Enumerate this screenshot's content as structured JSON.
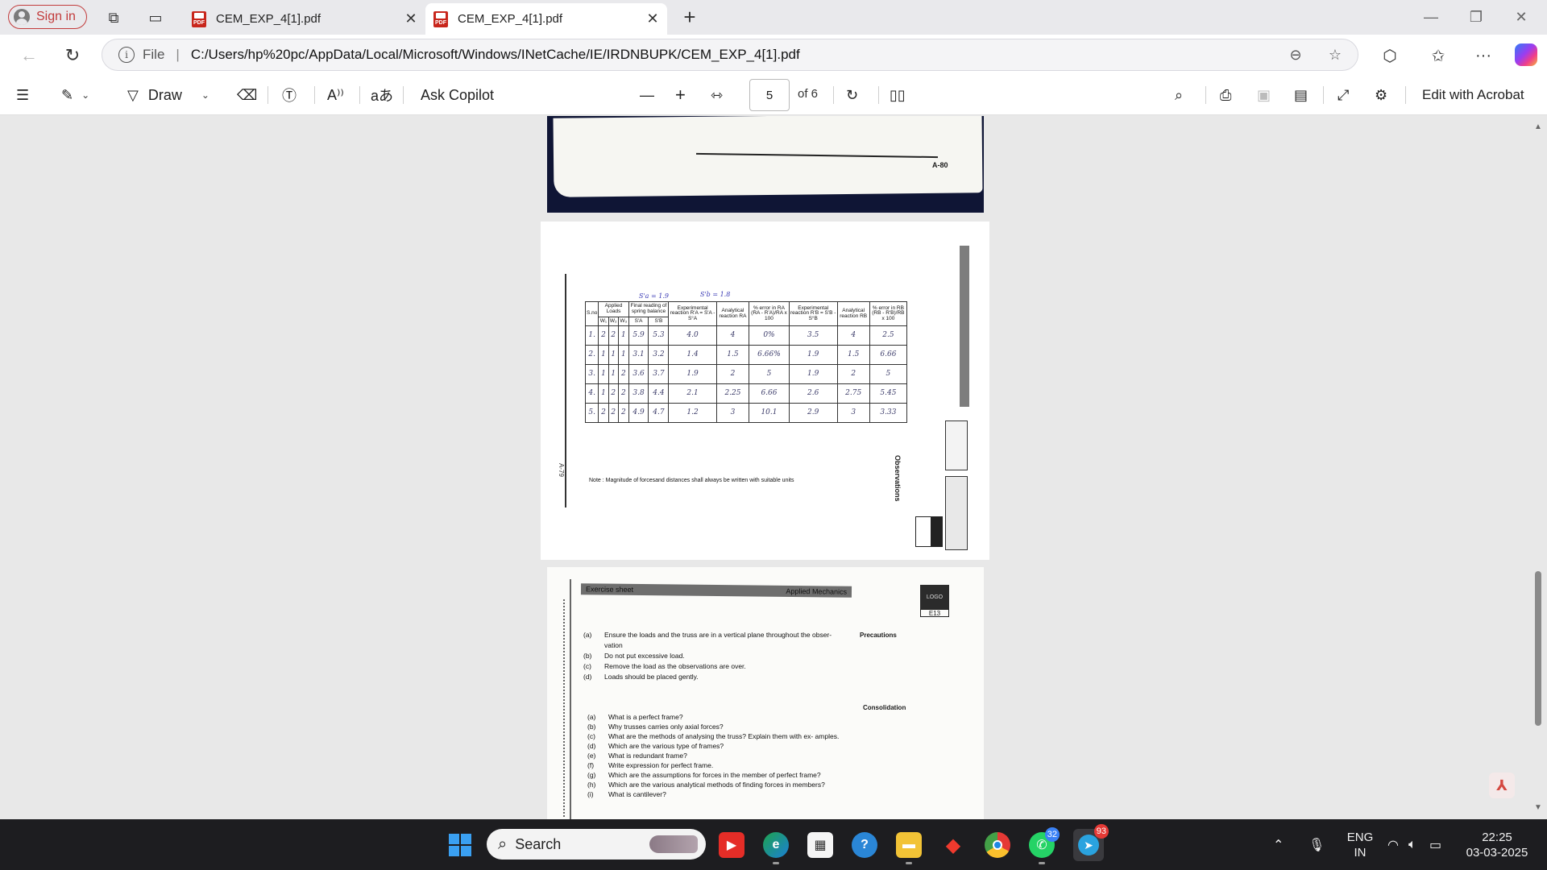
{
  "browser": {
    "sign_in_label": "Sign in",
    "tabs": [
      {
        "title": "CEM_EXP_4[1].pdf",
        "active": false
      },
      {
        "title": "CEM_EXP_4[1].pdf",
        "active": true
      }
    ],
    "new_tab_label": "+",
    "address": {
      "scheme_label": "File",
      "separator": "|",
      "url": "C:/Users/hp%20pc/AppData/Local/Microsoft/Windows/INetCache/IE/IRDNBUPK/CEM_EXP_4[1].pdf"
    },
    "window_controls": {
      "minimize": "—",
      "restore": "❐",
      "close": "✕"
    }
  },
  "pdf_toolbar": {
    "draw_label": "Draw",
    "ask_copilot_label": "Ask Copilot",
    "read_aloud_label": "A⁾⁾",
    "translate_label": "aあ",
    "current_page": "5",
    "page_count_label": "of 6",
    "edit_acrobat_label": "Edit with Acrobat"
  },
  "document": {
    "page1": {
      "code": "A-80"
    },
    "page2": {
      "page_code": "A-79",
      "side_title": "Observations",
      "handwritten_top_left": "S'a = 1.9",
      "handwritten_top_right": "S'b = 1.8",
      "table": {
        "headers": {
          "sno": "S.no",
          "applied_loads": "Applied Loads",
          "final_reading": "Final reading of spring balance",
          "exp_reaction_a": "Experimental reaction R'A = S'A - S°A",
          "analytical_a": "Analytical reaction RA",
          "error_a": "% error in RA  (RA - R'A)/RA x 100",
          "exp_reaction_b": "Experimental reaction R'B = S'B - S°B",
          "analytical_b": "Analytical reaction RB",
          "error_b": "% error in RB  (RB - R'B)/RB x 100"
        },
        "subheaders": [
          "W₁",
          "W₂",
          "W₃",
          "S'A",
          "S'B"
        ],
        "rows": [
          [
            "1.",
            "2",
            "2",
            "1",
            "5.9",
            "5.3",
            "4.0",
            "4",
            "0%",
            "3.5",
            "4",
            "2.5"
          ],
          [
            "2.",
            "1",
            "1",
            "1",
            "3.1",
            "3.2",
            "1.4",
            "1.5",
            "6.66%",
            "1.9",
            "1.5",
            "6.66"
          ],
          [
            "3.",
            "1",
            "1",
            "2",
            "3.6",
            "3.7",
            "1.9",
            "2",
            "5",
            "1.9",
            "2",
            "5"
          ],
          [
            "4.",
            "1",
            "2",
            "2",
            "3.8",
            "4.4",
            "2.1",
            "2.25",
            "6.66",
            "2.6",
            "2.75",
            "5.45"
          ],
          [
            "5.",
            "2",
            "2",
            "2",
            "4.9",
            "4.7",
            "1.2",
            "3",
            "10.1",
            "2.9",
            "3",
            "3.33"
          ]
        ],
        "note": "Note : Magnitude of forcesand distances shall always be written with suitable units"
      }
    },
    "page3": {
      "banner_left": "Exercise sheet",
      "banner_right": "Applied Mechanics",
      "logo_text": "LOGO",
      "code": "E13",
      "precautions_title": "Precautions",
      "precautions": [
        {
          "key": "(a)",
          "text": "Ensure the loads and the truss are in a vertical plane throughout the obser- vation"
        },
        {
          "key": "(b)",
          "text": "Do not put excessive load."
        },
        {
          "key": "(c)",
          "text": "Remove the load as the observations are over."
        },
        {
          "key": "(d)",
          "text": "Loads should be placed gently."
        }
      ],
      "consolidation_title": "Consolidation",
      "questions": [
        {
          "key": "(a)",
          "text": "What is a perfect frame?"
        },
        {
          "key": "(b)",
          "text": "Why trusses carries only axial forces?"
        },
        {
          "key": "(c)",
          "text": "What are the methods of analysing the truss? Explain them with ex- amples."
        },
        {
          "key": "(d)",
          "text": "Which are the various type of frames?"
        },
        {
          "key": "(e)",
          "text": "What is redundant frame?"
        },
        {
          "key": "(f)",
          "text": "Write expression for perfect frame."
        },
        {
          "key": "(g)",
          "text": "Which are the assumptions for forces in the member of perfect frame?"
        },
        {
          "key": "(h)",
          "text": "Which are the various analytical methods of finding forces in members?"
        },
        {
          "key": "(i)",
          "text": "What is cantilever?"
        }
      ]
    }
  },
  "taskbar": {
    "search_label": "Search",
    "whatsapp_badge": "32",
    "telegram_badge": "93",
    "language": "ENG",
    "region": "IN",
    "time": "22:25",
    "date": "03-03-2025"
  },
  "colors": {
    "accent_red": "#c23b3b",
    "taskbar": "#1d1d20",
    "start_blue": "#3aa0f2"
  }
}
